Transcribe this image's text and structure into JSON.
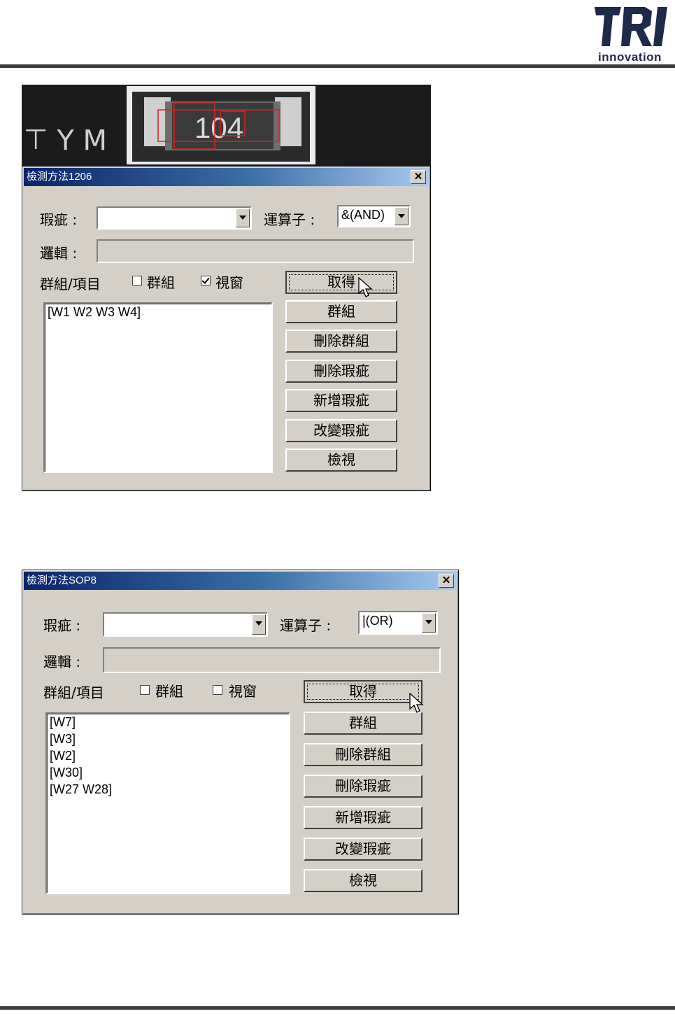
{
  "brand": {
    "logo_mark": "TRI",
    "logo_text": "innovation",
    "color": "#1e2a4a"
  },
  "pcb_image": {
    "component_marking": "104",
    "silkscreen_text": "ꟽ ⅄ ⊥",
    "highlight_color": "#e02020"
  },
  "dialogs": [
    {
      "title": "檢測方法1206",
      "defect_label": "瑕疵 :",
      "defect_value": "",
      "operator_label": "運算子 :",
      "operator_value": "&(AND)",
      "logic_label": "邏輯 :",
      "logic_value": "",
      "group_item_label": "群組/項目",
      "group_checkbox": {
        "label": "群組",
        "checked": false
      },
      "window_checkbox": {
        "label": "視窗",
        "checked": true
      },
      "list_items": [
        "[W1 W2 W3 W4]"
      ],
      "buttons": [
        "取得",
        "群組",
        "刪除群組",
        "刪除瑕疵",
        "新增瑕疵",
        "改變瑕疵",
        "檢視"
      ]
    },
    {
      "title": "檢測方法SOP8",
      "defect_label": "瑕疵 :",
      "defect_value": "",
      "operator_label": "運算子 :",
      "operator_value": "|(OR)",
      "logic_label": "邏輯 :",
      "logic_value": "",
      "group_item_label": "群組/項目",
      "group_checkbox": {
        "label": "群組",
        "checked": false
      },
      "window_checkbox": {
        "label": "視窗",
        "checked": false
      },
      "list_items": [
        "[W7]",
        "[W3]",
        "[W2]",
        "[W30]",
        "[W27 W28]"
      ],
      "buttons": [
        "取得",
        "群組",
        "刪除群組",
        "刪除瑕疵",
        "新增瑕疵",
        "改變瑕疵",
        "檢視"
      ]
    }
  ]
}
